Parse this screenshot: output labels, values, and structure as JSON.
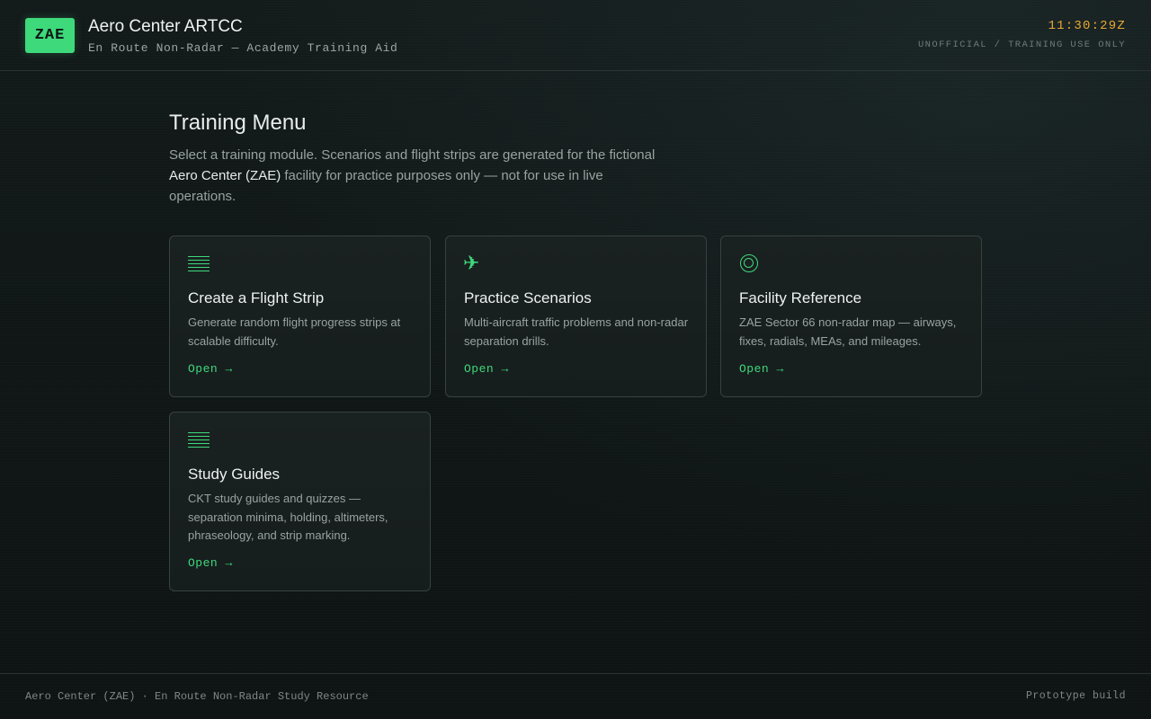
{
  "header": {
    "logo": "ZAE",
    "title": "Aero Center ARTCC",
    "subtitle": "En Route Non-Radar — Academy Training Aid",
    "clock": "11:30:29Z",
    "notice": "UNOFFICIAL / TRAINING USE ONLY"
  },
  "main": {
    "title": "Training Menu",
    "intro_before": "Select a training module. Scenarios and flight strips are generated for the fictional ",
    "intro_highlight": "Aero Center (ZAE)",
    "intro_after": " facility for practice purposes only — not for use in live operations.",
    "cards": [
      {
        "icon": "flight-strip-lines-icon",
        "title": "Create a Flight Strip",
        "description": "Generate random flight progress strips at scalable difficulty.",
        "link": "Open →"
      },
      {
        "icon": "airplane-icon",
        "title": "Practice Scenarios",
        "description": "Multi-aircraft traffic problems and non-radar separation drills.",
        "link": "Open →"
      },
      {
        "icon": "target-icon",
        "title": "Facility Reference",
        "description": "ZAE Sector 66 non-radar map — airways, fixes, radials, MEAs, and mileages.",
        "link": "Open →"
      },
      {
        "icon": "study-guide-lines-icon",
        "title": "Study Guides",
        "description": "CKT study guides and quizzes — separation minima, holding, altimeters, phraseology, and strip marking.",
        "link": "Open →"
      }
    ]
  },
  "footer": {
    "left": "Aero Center (ZAE) · En Route Non-Radar Study Resource",
    "right": "Prototype build"
  },
  "colors": {
    "accent": "#3ed97b",
    "clock": "#e8a932",
    "background": "#111717",
    "card_border": "#37423f"
  }
}
